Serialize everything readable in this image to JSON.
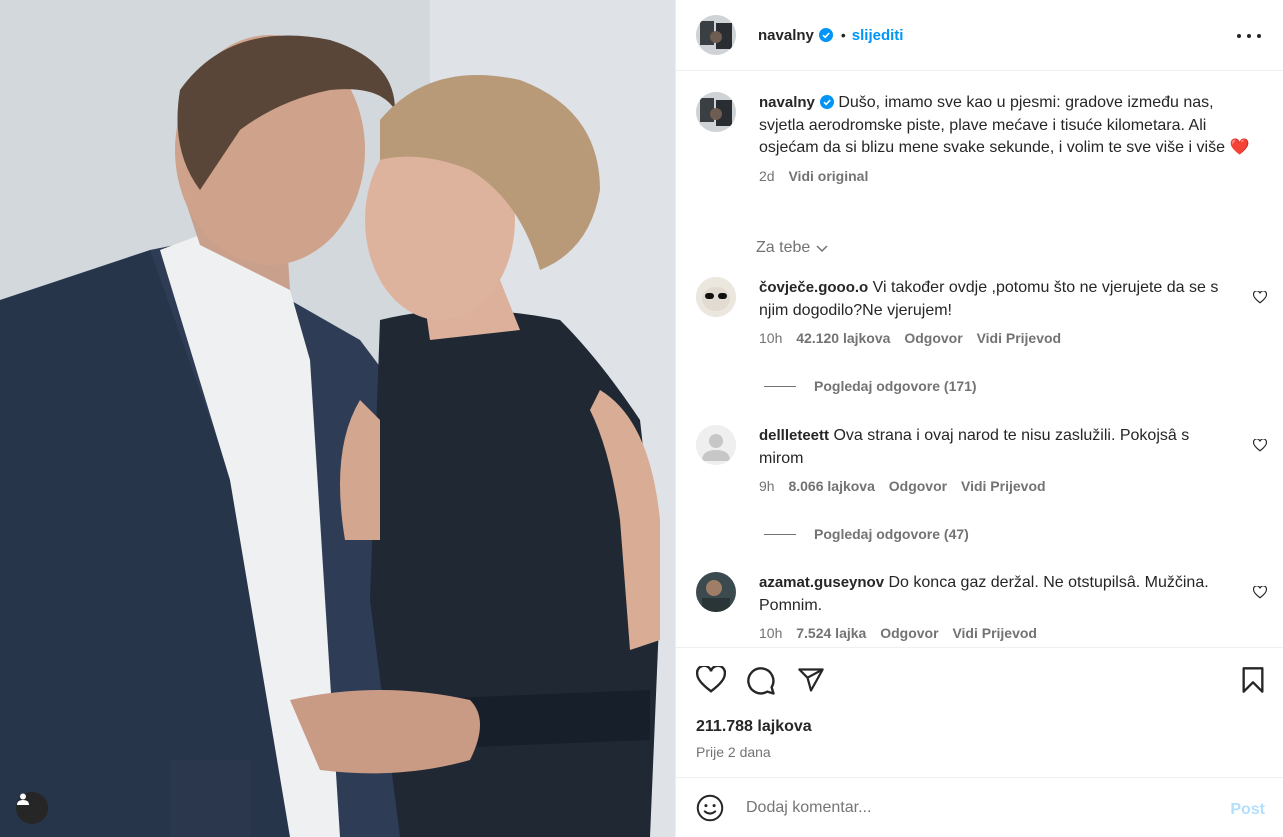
{
  "post": {
    "author": "navalny",
    "follow_label": "slijediti",
    "separator": "•",
    "more_icon": "more-options-icon"
  },
  "caption": {
    "author": "navalny",
    "text": "Dušo, imamo sve kao u pjesmi: gradove između nas, svjetla aerodromske piste, plave mećave i tisuće kilometara. Ali osjećam da si blizu mene svake sekunde, i volim te sve više i više",
    "emoji": "❤️",
    "time": "2d",
    "see_original": "Vidi original"
  },
  "for_you_label": "Za tebe",
  "comments": [
    {
      "user": "čovječe.gooo.o",
      "text": "Vi također ovdje ,potomu što ne vjerujete da se s njim dogodilo?Ne vjerujem!",
      "time": "10h",
      "likes": "42.120 lajkova",
      "reply": "Odgovor",
      "translate": "Vidi Prijevod",
      "view_replies": "Pogledaj odgovore (171)"
    },
    {
      "user": "dellleteett",
      "text": "Ova strana i ovaj narod te nisu zaslužili. Pokojsâ s mirom",
      "time": "9h",
      "likes": "8.066 lajkova",
      "reply": "Odgovor",
      "translate": "Vidi Prijevod",
      "view_replies": "Pogledaj odgovore (47)"
    },
    {
      "user": "azamat.guseynov",
      "text": "Do konca gaz deržal. Ne otstupilsâ. Mužčina. Pomnim.",
      "time": "10h",
      "likes": "7.524 lajka",
      "reply": "Odgovor",
      "translate": "Vidi Prijevod"
    }
  ],
  "likes_count": "211.788 lajkova",
  "posted_ago": "Prije 2 dana",
  "composer": {
    "placeholder": "Dodaj komentar...",
    "post_label": "Post"
  },
  "colors": {
    "link": "#0095f6",
    "muted": "#737373",
    "post_disabled": "#b2dffc",
    "heart_emoji": "#e0162b"
  }
}
